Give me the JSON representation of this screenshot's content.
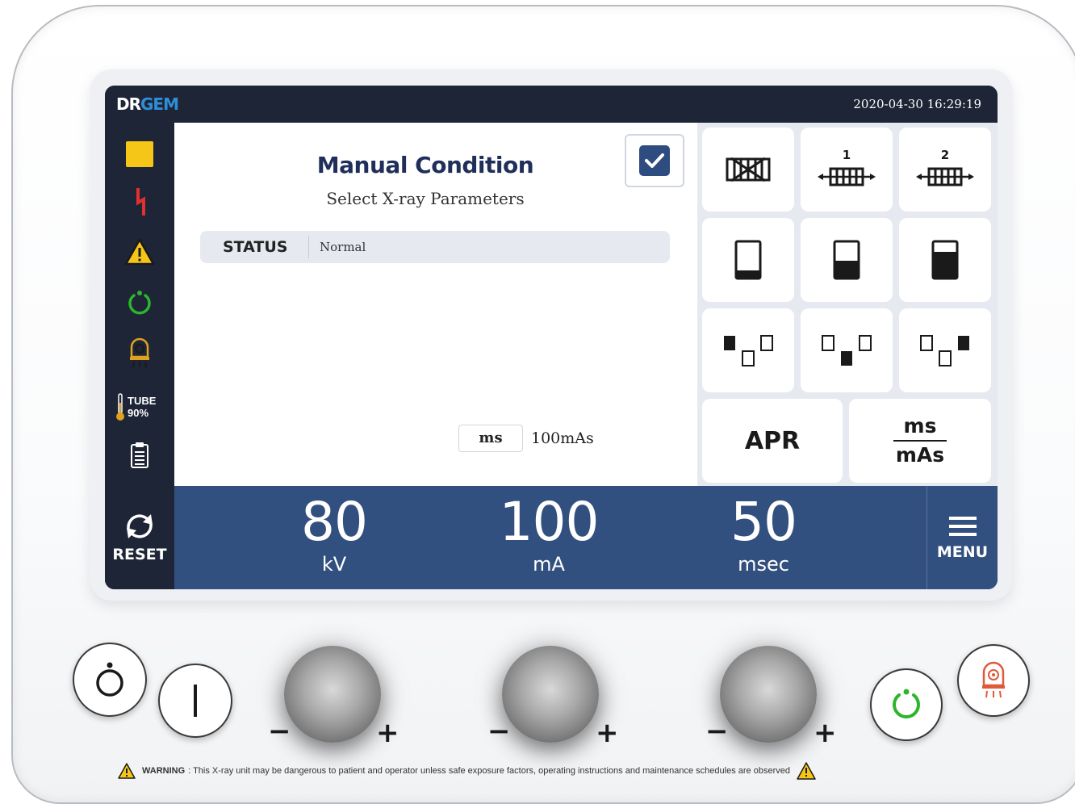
{
  "header": {
    "logo_dr": "DR",
    "logo_gem": "GEM",
    "datetime": "2020-04-30 16:29:19"
  },
  "sidebar": {
    "tube_label": "TUBE",
    "tube_percent": "90%"
  },
  "main": {
    "title": "Manual Condition",
    "subtitle": "Select X-ray Parameters",
    "status_label": "STATUS",
    "status_value": "Normal",
    "time_mode": "ms",
    "mas_value": "100mAs"
  },
  "grid": {
    "apr_label": "APR",
    "ms_label": "ms",
    "mas_label": "mAs",
    "bucky1_label": "1",
    "bucky2_label": "2"
  },
  "params": {
    "kv_value": "80",
    "kv_unit": "kV",
    "ma_value": "100",
    "ma_unit": "mA",
    "ms_value": "50",
    "ms_unit": "msec"
  },
  "bottom": {
    "reset_label": "RESET",
    "menu_label": "MENU"
  },
  "hardware": {
    "minus": "−",
    "plus": "+",
    "warning_title": "WARNING",
    "warning_text": ": This X-ray unit may be dangerous to patient and operator unless safe exposure factors, operating instructions and maintenance schedules are observed"
  },
  "colors": {
    "navy": "#1e2536",
    "blue_bar": "#32507f",
    "title_blue": "#1f2f5a",
    "accent_yellow": "#f5c518",
    "alert_red": "#e03030",
    "ready_green": "#2db52d",
    "exposure_orange": "#e05a3a"
  }
}
